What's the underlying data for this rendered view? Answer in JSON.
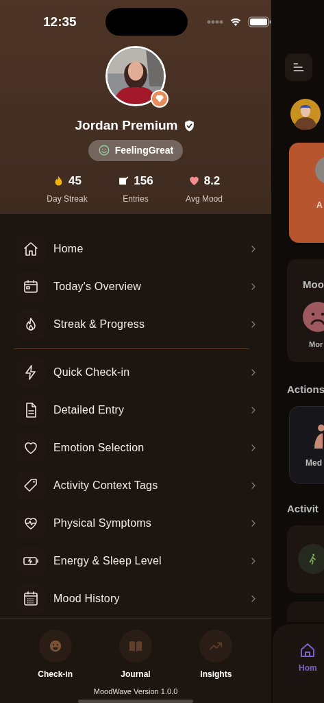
{
  "status_bar": {
    "time": "12:35"
  },
  "profile": {
    "name": "Jordan Premium",
    "verified": true,
    "premium": true,
    "mood_badge": "FeelingGreat",
    "stats": [
      {
        "kind": "streak",
        "value": "45",
        "label": "Day Streak"
      },
      {
        "kind": "entries",
        "value": "156",
        "label": "Entries"
      },
      {
        "kind": "mood",
        "value": "8.2",
        "label": "Avg Mood"
      }
    ]
  },
  "menu_sections": [
    [
      {
        "kind": "home",
        "label": "Home"
      },
      {
        "kind": "overview",
        "label": "Today's Overview"
      },
      {
        "kind": "streak",
        "label": "Streak & Progress"
      }
    ],
    [
      {
        "kind": "quick",
        "label": "Quick Check-in"
      },
      {
        "kind": "entry",
        "label": "Detailed Entry"
      },
      {
        "kind": "emotion",
        "label": "Emotion Selection"
      },
      {
        "kind": "tags",
        "label": "Activity Context Tags"
      },
      {
        "kind": "symptoms",
        "label": "Physical Symptoms"
      },
      {
        "kind": "energy",
        "label": "Energy & Sleep Level"
      },
      {
        "kind": "history",
        "label": "Mood History"
      }
    ]
  ],
  "bottom_actions": [
    {
      "kind": "checkin",
      "label": "Check-in"
    },
    {
      "kind": "journal",
      "label": "Journal"
    },
    {
      "kind": "insights",
      "label": "Insights"
    }
  ],
  "version": "MoodWave Version 1.0.0",
  "background_screen": {
    "card_label": "A",
    "mood_title": "Moo",
    "mood_option": "Mor",
    "actions_title": "Actions",
    "action_label": "Med",
    "activity_title": "Activit",
    "tab_label": "Hom"
  }
}
